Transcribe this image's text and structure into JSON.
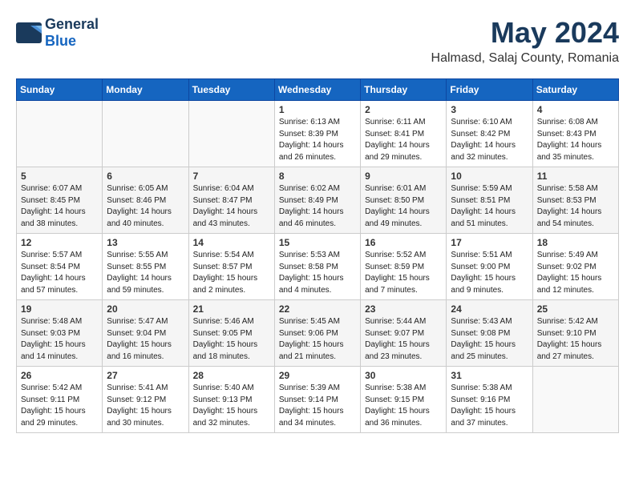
{
  "header": {
    "logo_general": "General",
    "logo_blue": "Blue",
    "month_title": "May 2024",
    "location": "Halmasd, Salaj County, Romania"
  },
  "calendar": {
    "headers": [
      "Sunday",
      "Monday",
      "Tuesday",
      "Wednesday",
      "Thursday",
      "Friday",
      "Saturday"
    ],
    "rows": [
      [
        {
          "day": "",
          "info": ""
        },
        {
          "day": "",
          "info": ""
        },
        {
          "day": "",
          "info": ""
        },
        {
          "day": "1",
          "info": "Sunrise: 6:13 AM\nSunset: 8:39 PM\nDaylight: 14 hours\nand 26 minutes."
        },
        {
          "day": "2",
          "info": "Sunrise: 6:11 AM\nSunset: 8:41 PM\nDaylight: 14 hours\nand 29 minutes."
        },
        {
          "day": "3",
          "info": "Sunrise: 6:10 AM\nSunset: 8:42 PM\nDaylight: 14 hours\nand 32 minutes."
        },
        {
          "day": "4",
          "info": "Sunrise: 6:08 AM\nSunset: 8:43 PM\nDaylight: 14 hours\nand 35 minutes."
        }
      ],
      [
        {
          "day": "5",
          "info": "Sunrise: 6:07 AM\nSunset: 8:45 PM\nDaylight: 14 hours\nand 38 minutes."
        },
        {
          "day": "6",
          "info": "Sunrise: 6:05 AM\nSunset: 8:46 PM\nDaylight: 14 hours\nand 40 minutes."
        },
        {
          "day": "7",
          "info": "Sunrise: 6:04 AM\nSunset: 8:47 PM\nDaylight: 14 hours\nand 43 minutes."
        },
        {
          "day": "8",
          "info": "Sunrise: 6:02 AM\nSunset: 8:49 PM\nDaylight: 14 hours\nand 46 minutes."
        },
        {
          "day": "9",
          "info": "Sunrise: 6:01 AM\nSunset: 8:50 PM\nDaylight: 14 hours\nand 49 minutes."
        },
        {
          "day": "10",
          "info": "Sunrise: 5:59 AM\nSunset: 8:51 PM\nDaylight: 14 hours\nand 51 minutes."
        },
        {
          "day": "11",
          "info": "Sunrise: 5:58 AM\nSunset: 8:53 PM\nDaylight: 14 hours\nand 54 minutes."
        }
      ],
      [
        {
          "day": "12",
          "info": "Sunrise: 5:57 AM\nSunset: 8:54 PM\nDaylight: 14 hours\nand 57 minutes."
        },
        {
          "day": "13",
          "info": "Sunrise: 5:55 AM\nSunset: 8:55 PM\nDaylight: 14 hours\nand 59 minutes."
        },
        {
          "day": "14",
          "info": "Sunrise: 5:54 AM\nSunset: 8:57 PM\nDaylight: 15 hours\nand 2 minutes."
        },
        {
          "day": "15",
          "info": "Sunrise: 5:53 AM\nSunset: 8:58 PM\nDaylight: 15 hours\nand 4 minutes."
        },
        {
          "day": "16",
          "info": "Sunrise: 5:52 AM\nSunset: 8:59 PM\nDaylight: 15 hours\nand 7 minutes."
        },
        {
          "day": "17",
          "info": "Sunrise: 5:51 AM\nSunset: 9:00 PM\nDaylight: 15 hours\nand 9 minutes."
        },
        {
          "day": "18",
          "info": "Sunrise: 5:49 AM\nSunset: 9:02 PM\nDaylight: 15 hours\nand 12 minutes."
        }
      ],
      [
        {
          "day": "19",
          "info": "Sunrise: 5:48 AM\nSunset: 9:03 PM\nDaylight: 15 hours\nand 14 minutes."
        },
        {
          "day": "20",
          "info": "Sunrise: 5:47 AM\nSunset: 9:04 PM\nDaylight: 15 hours\nand 16 minutes."
        },
        {
          "day": "21",
          "info": "Sunrise: 5:46 AM\nSunset: 9:05 PM\nDaylight: 15 hours\nand 18 minutes."
        },
        {
          "day": "22",
          "info": "Sunrise: 5:45 AM\nSunset: 9:06 PM\nDaylight: 15 hours\nand 21 minutes."
        },
        {
          "day": "23",
          "info": "Sunrise: 5:44 AM\nSunset: 9:07 PM\nDaylight: 15 hours\nand 23 minutes."
        },
        {
          "day": "24",
          "info": "Sunrise: 5:43 AM\nSunset: 9:08 PM\nDaylight: 15 hours\nand 25 minutes."
        },
        {
          "day": "25",
          "info": "Sunrise: 5:42 AM\nSunset: 9:10 PM\nDaylight: 15 hours\nand 27 minutes."
        }
      ],
      [
        {
          "day": "26",
          "info": "Sunrise: 5:42 AM\nSunset: 9:11 PM\nDaylight: 15 hours\nand 29 minutes."
        },
        {
          "day": "27",
          "info": "Sunrise: 5:41 AM\nSunset: 9:12 PM\nDaylight: 15 hours\nand 30 minutes."
        },
        {
          "day": "28",
          "info": "Sunrise: 5:40 AM\nSunset: 9:13 PM\nDaylight: 15 hours\nand 32 minutes."
        },
        {
          "day": "29",
          "info": "Sunrise: 5:39 AM\nSunset: 9:14 PM\nDaylight: 15 hours\nand 34 minutes."
        },
        {
          "day": "30",
          "info": "Sunrise: 5:38 AM\nSunset: 9:15 PM\nDaylight: 15 hours\nand 36 minutes."
        },
        {
          "day": "31",
          "info": "Sunrise: 5:38 AM\nSunset: 9:16 PM\nDaylight: 15 hours\nand 37 minutes."
        },
        {
          "day": "",
          "info": ""
        }
      ]
    ]
  }
}
